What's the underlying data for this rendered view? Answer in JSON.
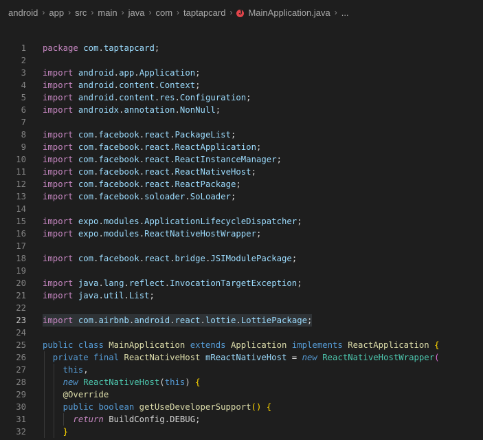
{
  "breadcrumb": {
    "items": [
      "android",
      "app",
      "src",
      "main",
      "java",
      "com",
      "taptapcard"
    ],
    "file": "MainApplication.java",
    "more": "..."
  },
  "editor": {
    "active_line": 23,
    "lines": [
      {
        "n": "1",
        "tokens": [
          [
            "package ",
            "kw"
          ],
          [
            "com",
            "pkg"
          ],
          [
            ".",
            "punc"
          ],
          [
            "taptapcard",
            "pkg"
          ],
          [
            ";",
            "punc"
          ]
        ]
      },
      {
        "n": "2",
        "tokens": []
      },
      {
        "n": "3",
        "tokens": [
          [
            "import ",
            "kw"
          ],
          [
            "android",
            "pkg"
          ],
          [
            ".",
            "punc"
          ],
          [
            "app",
            "pkg"
          ],
          [
            ".",
            "punc"
          ],
          [
            "Application",
            "pkg"
          ],
          [
            ";",
            "punc"
          ]
        ]
      },
      {
        "n": "4",
        "tokens": [
          [
            "import ",
            "kw"
          ],
          [
            "android",
            "pkg"
          ],
          [
            ".",
            "punc"
          ],
          [
            "content",
            "pkg"
          ],
          [
            ".",
            "punc"
          ],
          [
            "Context",
            "pkg"
          ],
          [
            ";",
            "punc"
          ]
        ]
      },
      {
        "n": "5",
        "tokens": [
          [
            "import ",
            "kw"
          ],
          [
            "android",
            "pkg"
          ],
          [
            ".",
            "punc"
          ],
          [
            "content",
            "pkg"
          ],
          [
            ".",
            "punc"
          ],
          [
            "res",
            "pkg"
          ],
          [
            ".",
            "punc"
          ],
          [
            "Configuration",
            "pkg"
          ],
          [
            ";",
            "punc"
          ]
        ]
      },
      {
        "n": "6",
        "tokens": [
          [
            "import ",
            "kw"
          ],
          [
            "androidx",
            "pkg"
          ],
          [
            ".",
            "punc"
          ],
          [
            "annotation",
            "pkg"
          ],
          [
            ".",
            "punc"
          ],
          [
            "NonNull",
            "pkg"
          ],
          [
            ";",
            "punc"
          ]
        ]
      },
      {
        "n": "7",
        "tokens": []
      },
      {
        "n": "8",
        "tokens": [
          [
            "import ",
            "kw"
          ],
          [
            "com",
            "pkg"
          ],
          [
            ".",
            "punc"
          ],
          [
            "facebook",
            "pkg"
          ],
          [
            ".",
            "punc"
          ],
          [
            "react",
            "pkg"
          ],
          [
            ".",
            "punc"
          ],
          [
            "PackageList",
            "pkg"
          ],
          [
            ";",
            "punc"
          ]
        ]
      },
      {
        "n": "9",
        "tokens": [
          [
            "import ",
            "kw"
          ],
          [
            "com",
            "pkg"
          ],
          [
            ".",
            "punc"
          ],
          [
            "facebook",
            "pkg"
          ],
          [
            ".",
            "punc"
          ],
          [
            "react",
            "pkg"
          ],
          [
            ".",
            "punc"
          ],
          [
            "ReactApplication",
            "pkg"
          ],
          [
            ";",
            "punc"
          ]
        ]
      },
      {
        "n": "10",
        "tokens": [
          [
            "import ",
            "kw"
          ],
          [
            "com",
            "pkg"
          ],
          [
            ".",
            "punc"
          ],
          [
            "facebook",
            "pkg"
          ],
          [
            ".",
            "punc"
          ],
          [
            "react",
            "pkg"
          ],
          [
            ".",
            "punc"
          ],
          [
            "ReactInstanceManager",
            "pkg"
          ],
          [
            ";",
            "punc"
          ]
        ]
      },
      {
        "n": "11",
        "tokens": [
          [
            "import ",
            "kw"
          ],
          [
            "com",
            "pkg"
          ],
          [
            ".",
            "punc"
          ],
          [
            "facebook",
            "pkg"
          ],
          [
            ".",
            "punc"
          ],
          [
            "react",
            "pkg"
          ],
          [
            ".",
            "punc"
          ],
          [
            "ReactNativeHost",
            "pkg"
          ],
          [
            ";",
            "punc"
          ]
        ]
      },
      {
        "n": "12",
        "tokens": [
          [
            "import ",
            "kw"
          ],
          [
            "com",
            "pkg"
          ],
          [
            ".",
            "punc"
          ],
          [
            "facebook",
            "pkg"
          ],
          [
            ".",
            "punc"
          ],
          [
            "react",
            "pkg"
          ],
          [
            ".",
            "punc"
          ],
          [
            "ReactPackage",
            "pkg"
          ],
          [
            ";",
            "punc"
          ]
        ]
      },
      {
        "n": "13",
        "tokens": [
          [
            "import ",
            "kw"
          ],
          [
            "com",
            "pkg"
          ],
          [
            ".",
            "punc"
          ],
          [
            "facebook",
            "pkg"
          ],
          [
            ".",
            "punc"
          ],
          [
            "soloader",
            "pkg"
          ],
          [
            ".",
            "punc"
          ],
          [
            "SoLoader",
            "pkg"
          ],
          [
            ";",
            "punc"
          ]
        ]
      },
      {
        "n": "14",
        "tokens": []
      },
      {
        "n": "15",
        "tokens": [
          [
            "import ",
            "kw"
          ],
          [
            "expo",
            "pkg"
          ],
          [
            ".",
            "punc"
          ],
          [
            "modules",
            "pkg"
          ],
          [
            ".",
            "punc"
          ],
          [
            "ApplicationLifecycleDispatcher",
            "pkg"
          ],
          [
            ";",
            "punc"
          ]
        ]
      },
      {
        "n": "16",
        "tokens": [
          [
            "import ",
            "kw"
          ],
          [
            "expo",
            "pkg"
          ],
          [
            ".",
            "punc"
          ],
          [
            "modules",
            "pkg"
          ],
          [
            ".",
            "punc"
          ],
          [
            "ReactNativeHostWrapper",
            "pkg"
          ],
          [
            ";",
            "punc"
          ]
        ]
      },
      {
        "n": "17",
        "tokens": []
      },
      {
        "n": "18",
        "tokens": [
          [
            "import ",
            "kw"
          ],
          [
            "com",
            "pkg"
          ],
          [
            ".",
            "punc"
          ],
          [
            "facebook",
            "pkg"
          ],
          [
            ".",
            "punc"
          ],
          [
            "react",
            "pkg"
          ],
          [
            ".",
            "punc"
          ],
          [
            "bridge",
            "pkg"
          ],
          [
            ".",
            "punc"
          ],
          [
            "JSIModulePackage",
            "pkg"
          ],
          [
            ";",
            "punc"
          ]
        ]
      },
      {
        "n": "19",
        "tokens": []
      },
      {
        "n": "20",
        "tokens": [
          [
            "import ",
            "kw"
          ],
          [
            "java",
            "pkg"
          ],
          [
            ".",
            "punc"
          ],
          [
            "lang",
            "pkg"
          ],
          [
            ".",
            "punc"
          ],
          [
            "reflect",
            "pkg"
          ],
          [
            ".",
            "punc"
          ],
          [
            "InvocationTargetException",
            "pkg"
          ],
          [
            ";",
            "punc"
          ]
        ]
      },
      {
        "n": "21",
        "tokens": [
          [
            "import ",
            "kw"
          ],
          [
            "java",
            "pkg"
          ],
          [
            ".",
            "punc"
          ],
          [
            "util",
            "pkg"
          ],
          [
            ".",
            "punc"
          ],
          [
            "List",
            "pkg"
          ],
          [
            ";",
            "punc"
          ]
        ]
      },
      {
        "n": "22",
        "tokens": []
      },
      {
        "n": "23",
        "tokens": [
          [
            "import ",
            "kw"
          ],
          [
            "com",
            "pkg"
          ],
          [
            ".",
            "punc"
          ],
          [
            "airbnb",
            "pkg"
          ],
          [
            ".",
            "punc"
          ],
          [
            "android",
            "pkg"
          ],
          [
            ".",
            "punc"
          ],
          [
            "react",
            "pkg"
          ],
          [
            ".",
            "punc"
          ],
          [
            "lottie",
            "pkg"
          ],
          [
            ".",
            "punc"
          ],
          [
            "LottiePackage",
            "pkg"
          ],
          [
            ";",
            "punc"
          ]
        ]
      },
      {
        "n": "24",
        "tokens": []
      },
      {
        "n": "25",
        "tokens": [
          [
            "public ",
            "kw2"
          ],
          [
            "class ",
            "kw2"
          ],
          [
            "MainApplication ",
            "cls"
          ],
          [
            "extends ",
            "kw2"
          ],
          [
            "Application ",
            "cls"
          ],
          [
            "implements ",
            "kw2"
          ],
          [
            "ReactApplication ",
            "cls"
          ],
          [
            "{",
            "brace1"
          ]
        ]
      },
      {
        "n": "26",
        "tokens": [
          [
            "  private ",
            "kw2"
          ],
          [
            "final ",
            "kw2"
          ],
          [
            "ReactNativeHost ",
            "cls"
          ],
          [
            "mReactNativeHost ",
            "var"
          ],
          [
            "= ",
            "punc"
          ],
          [
            "new ",
            "kw2 ital"
          ],
          [
            "ReactNativeHostWrapper",
            "type"
          ],
          [
            "(",
            "brace2"
          ]
        ]
      },
      {
        "n": "27",
        "tokens": [
          [
            "    this",
            "kw2"
          ],
          [
            ",",
            "punc"
          ]
        ]
      },
      {
        "n": "28",
        "tokens": [
          [
            "    new ",
            "kw2 ital"
          ],
          [
            "ReactNativeHost",
            "type"
          ],
          [
            "(",
            "punc"
          ],
          [
            "this",
            "kw2"
          ],
          [
            ") ",
            "punc"
          ],
          [
            "{",
            "brace1"
          ]
        ]
      },
      {
        "n": "29",
        "tokens": [
          [
            "    @Override",
            "anno"
          ]
        ]
      },
      {
        "n": "30",
        "tokens": [
          [
            "    public ",
            "kw2"
          ],
          [
            "boolean ",
            "kw2"
          ],
          [
            "getUseDeveloperSupport",
            "fn"
          ],
          [
            "() ",
            "brace1"
          ],
          [
            "{",
            "brace1"
          ]
        ]
      },
      {
        "n": "31",
        "tokens": [
          [
            "      return ",
            "kw ital"
          ],
          [
            "BuildConfig",
            "punc"
          ],
          [
            ".",
            "punc"
          ],
          [
            "DEBUG",
            "punc"
          ],
          [
            ";",
            "punc"
          ]
        ]
      },
      {
        "n": "32",
        "tokens": [
          [
            "    }",
            "brace1"
          ]
        ]
      }
    ]
  }
}
